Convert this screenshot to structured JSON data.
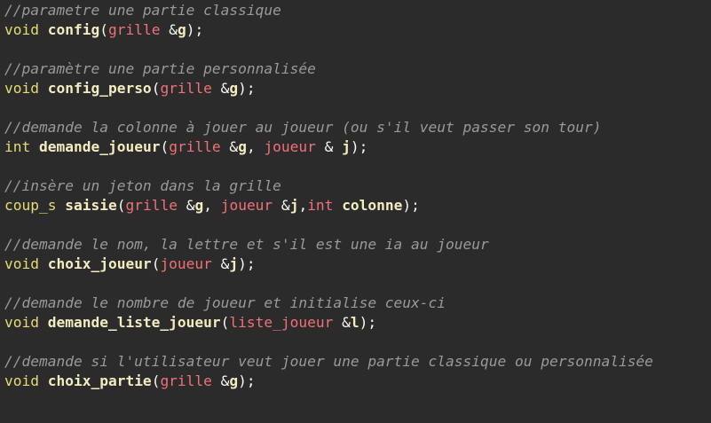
{
  "colors": {
    "background": "#2b2b2b",
    "comment": "#9a9a9a",
    "type": "#e6db74",
    "function": "#f3ecc0",
    "param": "#f07178",
    "punctuation": "#f8f8f2"
  },
  "blocks": [
    {
      "comment": "//parametre une partie classique",
      "ret": "void",
      "name": "config",
      "params": [
        {
          "type": "grille",
          "ref": " &",
          "var": "g"
        }
      ],
      "sep": ", ",
      "close": ");"
    },
    {
      "comment": "//paramètre une partie personnalisée",
      "ret": "void",
      "name": "config_perso",
      "params": [
        {
          "type": "grille",
          "ref": " &",
          "var": "g"
        }
      ],
      "sep": ", ",
      "close": ");"
    },
    {
      "comment": "//demande la colonne à jouer au joueur (ou s'il veut passer son tour)",
      "ret": "int",
      "name": "demande_joueur",
      "params": [
        {
          "type": "grille",
          "ref": " &",
          "var": "g"
        },
        {
          "type": "joueur",
          "ref": " & ",
          "var": "j"
        }
      ],
      "sep": ", ",
      "close": ");"
    },
    {
      "comment": "//insère un jeton dans la grille",
      "ret": "coup_s",
      "name": "saisie",
      "params": [
        {
          "type": "grille",
          "ref": " &",
          "var": "g"
        },
        {
          "type": "joueur",
          "ref": " &",
          "var": "j"
        },
        {
          "type": "int",
          "ref": " ",
          "var": "colonne"
        }
      ],
      "seps": [
        ", ",
        ","
      ],
      "close": ");"
    },
    {
      "comment": "//demande le nom, la lettre et s'il est une ia au joueur",
      "ret": "void",
      "name": "choix_joueur",
      "params": [
        {
          "type": "joueur",
          "ref": " &",
          "var": "j"
        }
      ],
      "sep": ", ",
      "close": ");"
    },
    {
      "comment": "//demande le nombre de joueur et initialise ceux-ci",
      "ret": "void",
      "name": "demande_liste_joueur",
      "params": [
        {
          "type": "liste_joueur",
          "ref": " &",
          "var": "l"
        }
      ],
      "sep": ", ",
      "close": ");"
    },
    {
      "comment": "//demande si l'utilisateur veut jouer une partie classique ou personnalisée",
      "ret": "void",
      "name": "choix_partie",
      "params": [
        {
          "type": "grille",
          "ref": " &",
          "var": "g"
        }
      ],
      "sep": ", ",
      "close": ");"
    }
  ]
}
